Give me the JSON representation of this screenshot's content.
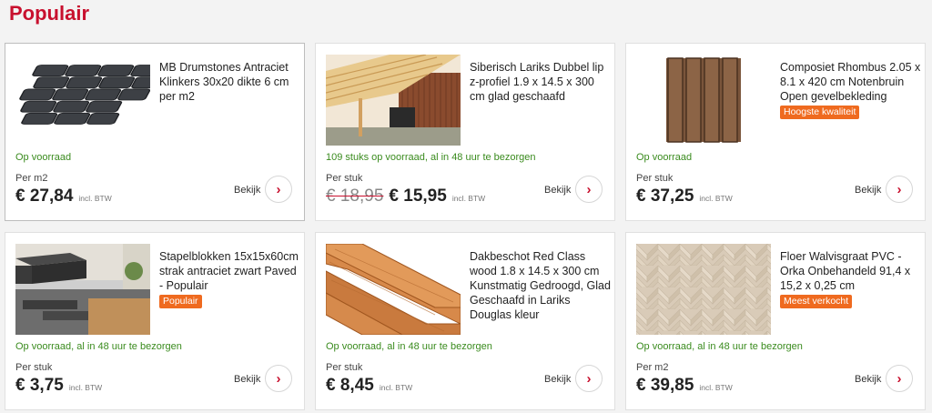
{
  "section": {
    "title": "Populair"
  },
  "ui": {
    "view_label": "Bekijk",
    "chevron_icon": "chevron-right-icon"
  },
  "colors": {
    "brand": "#c8102e",
    "stock": "#3a8b1e",
    "badge": "#ef6a1f"
  },
  "products": [
    {
      "title": "MB Drumstones Antraciet Klinkers 30x20 dikte 6 cm per m2",
      "badge": "",
      "stock": "Op voorraad",
      "unit": "Per m2",
      "old_price": "",
      "price": "€ 27,84",
      "vat": "incl. BTW",
      "image": "anthracite-paving-stones"
    },
    {
      "title": "Siberisch Lariks Dubbel lip z-profiel 1.9 x 14.5 x 300 cm glad geschaafd",
      "badge": "",
      "stock": "109 stuks op voorraad, al in 48 uur te bezorgen",
      "unit": "Per stuk",
      "old_price": "€ 18,95",
      "price": "€ 15,95",
      "vat": "incl. BTW",
      "image": "larch-wood-cladding"
    },
    {
      "title": "Composiet Rhombus 2.05 x 8.1 x 420 cm Notenbruin Open gevelbekleding",
      "badge": "Hoogste kwaliteit",
      "stock": "Op voorraad",
      "unit": "Per stuk",
      "old_price": "",
      "price": "€ 37,25",
      "vat": "incl. BTW",
      "image": "composite-rhombus-planks"
    },
    {
      "title": "Stapelblokken 15x15x60cm strak antraciet zwart Paved - Populair",
      "badge": "Populair",
      "stock": "Op voorraad, al in 48 uur te bezorgen",
      "unit": "Per stuk",
      "old_price": "",
      "price": "€ 3,75",
      "vat": "incl. BTW",
      "image": "stacking-block"
    },
    {
      "title": "Dakbeschot Red Class wood 1.8 x 14.5 x 300 cm Kunstmatig Gedroogd, Glad Geschaafd in Lariks Douglas kleur",
      "badge": "",
      "stock": "Op voorraad, al in 48 uur te bezorgen",
      "unit": "Per stuk",
      "old_price": "",
      "price": "€ 8,45",
      "vat": "incl. BTW",
      "image": "roof-boarding-planks"
    },
    {
      "title": "Floer Walvisgraat PVC - Orka Onbehandeld 91,4 x 15,2 x 0,25 cm",
      "badge": "Meest verkocht",
      "stock": "Op voorraad, al in 48 uur te bezorgen",
      "unit": "Per m2",
      "old_price": "",
      "price": "€ 39,85",
      "vat": "incl. BTW",
      "image": "herringbone-pvc-floor"
    }
  ]
}
